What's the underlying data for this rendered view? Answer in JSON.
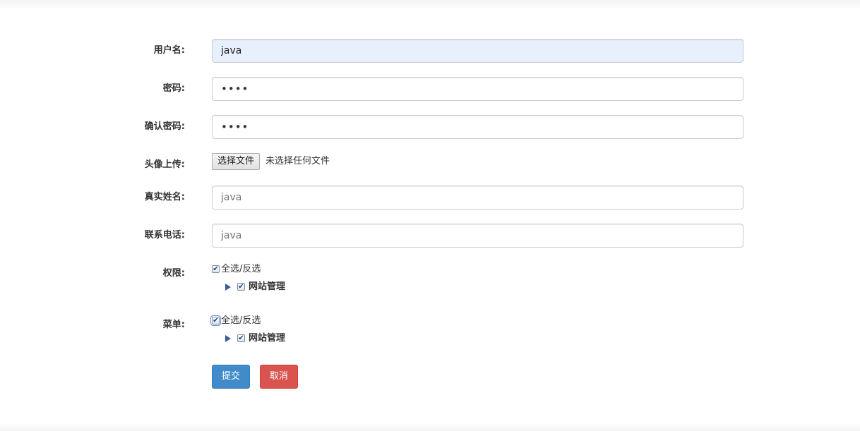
{
  "form": {
    "username": {
      "label": "用户名:",
      "value": "java"
    },
    "password": {
      "label": "密码:",
      "value": "••••"
    },
    "confirm_password": {
      "label": "确认密码:",
      "value": "••••"
    },
    "avatar": {
      "label": "头像上传:",
      "button_label": "选择文件",
      "status": "未选择任何文件"
    },
    "real_name": {
      "label": "真实姓名:",
      "placeholder": "java"
    },
    "phone": {
      "label": "联系电话:",
      "placeholder": "java"
    },
    "permissions": {
      "label": "权限:",
      "select_all_label": "全选/反选",
      "select_all_checked": true,
      "tree": [
        {
          "label": "网站管理",
          "checked": true,
          "expanded": false
        }
      ]
    },
    "menu": {
      "label": "菜单:",
      "select_all_label": "全选/反选",
      "select_all_checked": true,
      "tree": [
        {
          "label": "网站管理",
          "checked": true,
          "expanded": false
        }
      ]
    },
    "buttons": {
      "submit": "提交",
      "cancel": "取消"
    }
  },
  "icons": {
    "check_mark": "✔",
    "tree_toggle": "triangle-right-icon"
  },
  "colors": {
    "primary": "#428bca",
    "danger": "#d9534f",
    "autofill_bg": "#e8f0fe",
    "tree_toggle": "#3f5a94"
  }
}
